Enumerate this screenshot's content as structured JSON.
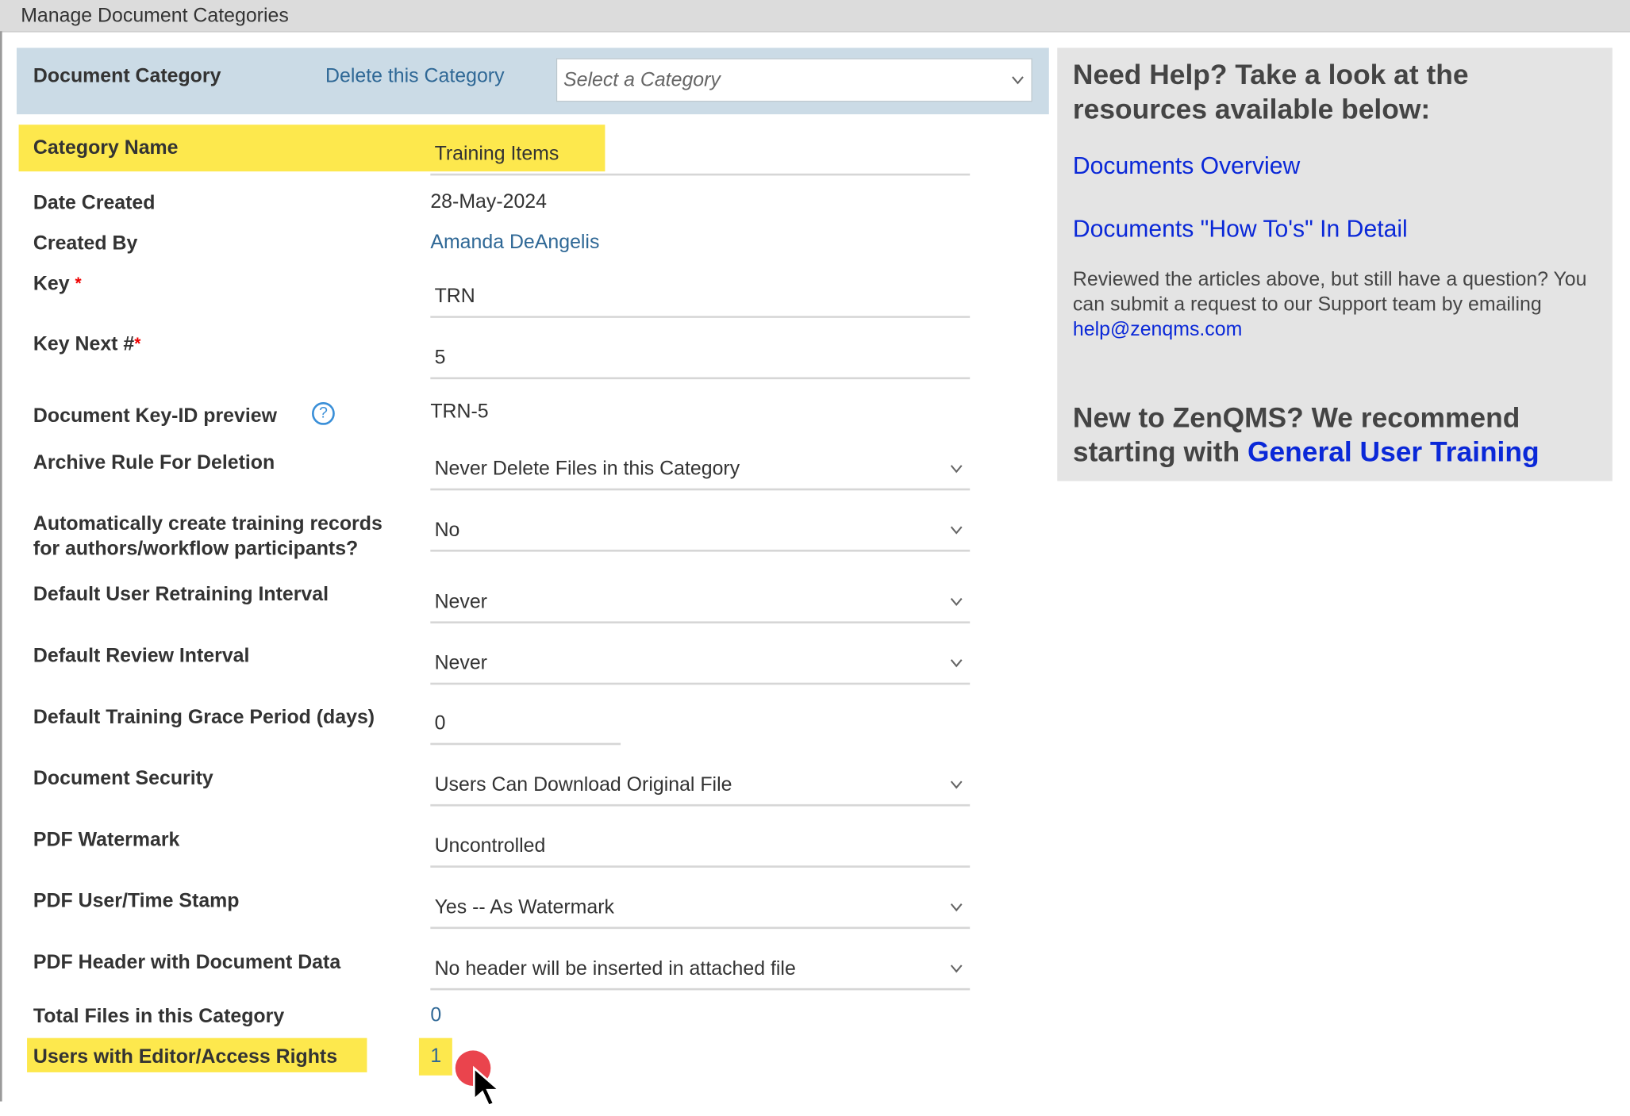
{
  "window": {
    "title": "Manage Document Categories"
  },
  "category_bar": {
    "label": "Document Category",
    "delete_link": "Delete this Category",
    "select_placeholder": "Select a Category"
  },
  "form": {
    "category_name": {
      "label": "Category Name",
      "value": "Training Items"
    },
    "date_created": {
      "label": "Date Created",
      "value": "28-May-2024"
    },
    "created_by": {
      "label": "Created By",
      "value": "Amanda DeAngelis"
    },
    "key": {
      "label": "Key",
      "required_mark": "*",
      "value": "TRN"
    },
    "key_next": {
      "label": "Key Next #",
      "required_mark": "*",
      "value": "5"
    },
    "key_id_preview": {
      "label": "Document Key-ID preview",
      "help_glyph": "?",
      "value": "TRN-5"
    },
    "archive_rule": {
      "label": "Archive Rule For Deletion",
      "value": "Never Delete Files in this Category"
    },
    "auto_training": {
      "label_line1": "Automatically create training records",
      "label_line2": "for authors/workflow participants?",
      "value": "No"
    },
    "retraining_interval": {
      "label": "Default User Retraining Interval",
      "value": "Never"
    },
    "review_interval": {
      "label": "Default Review Interval",
      "value": "Never"
    },
    "grace_period": {
      "label": "Default Training Grace Period (days)",
      "value": "0"
    },
    "document_security": {
      "label": "Document Security",
      "value": "Users Can Download Original File"
    },
    "pdf_watermark": {
      "label": "PDF Watermark",
      "value": "Uncontrolled"
    },
    "pdf_stamp": {
      "label": "PDF User/Time Stamp",
      "value": "Yes -- As Watermark"
    },
    "pdf_header": {
      "label": "PDF Header with Document Data",
      "value": "No header will be inserted in attached file"
    },
    "total_files": {
      "label": "Total Files in this Category",
      "value": "0"
    },
    "editor_rights": {
      "label": "Users with Editor/Access Rights",
      "value": "1"
    }
  },
  "help_panel": {
    "heading": "Need Help? Take a look at the resources available below:",
    "link_overview": "Documents Overview",
    "link_howto": "Documents \"How To's\" In Detail",
    "paragraph": "Reviewed the articles above, but still have a question? You can submit a request to our Support team by emailing ",
    "email": "help@zenqms.com",
    "new_heading": "New to ZenQMS? We recommend starting with ",
    "new_link": "General User Training"
  },
  "colors": {
    "highlight": "#fde84d",
    "link": "#2f6896",
    "help_link": "#0a28d8",
    "category_bar": "#cbdbe6",
    "click_marker": "#e8303a"
  },
  "icons": [
    "chevron-down-icon",
    "help-circle-icon",
    "mouse-pointer-icon"
  ]
}
